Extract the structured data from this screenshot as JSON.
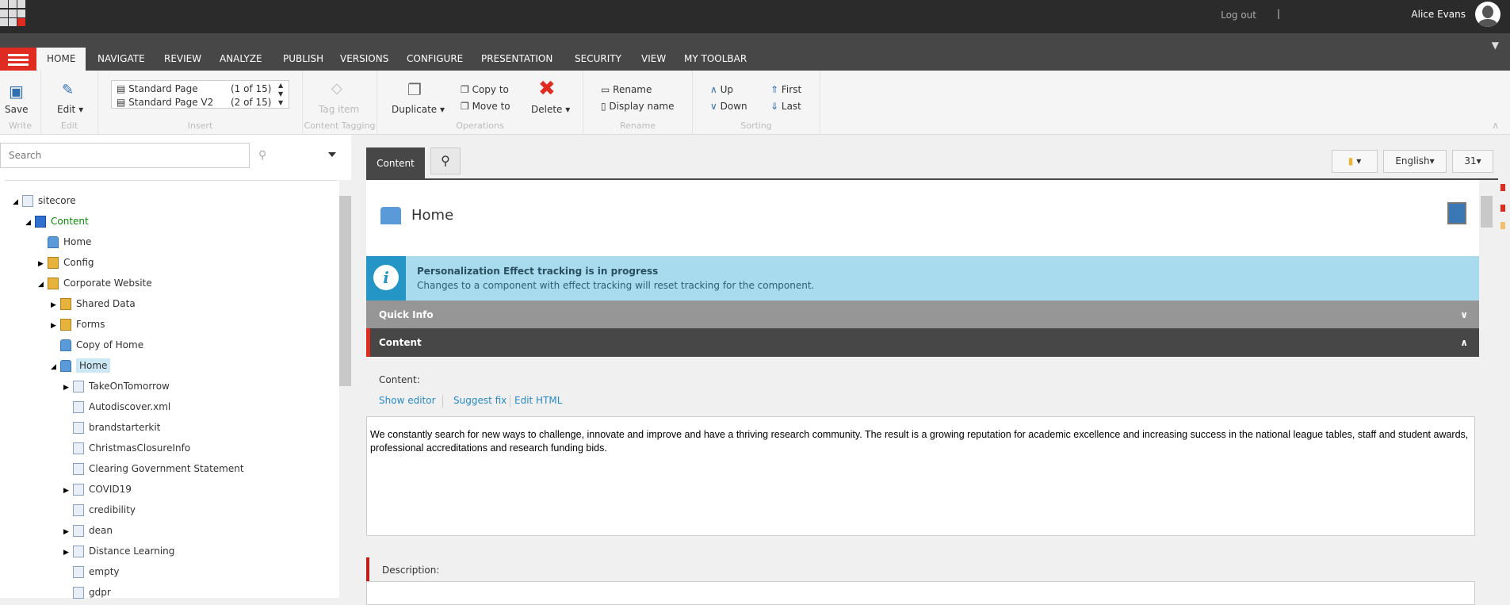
{
  "topbar": {
    "logout": "Log out",
    "separator": "|",
    "user": "Alice Evans"
  },
  "tabs": [
    "HOME",
    "NAVIGATE",
    "REVIEW",
    "ANALYZE",
    "PUBLISH",
    "VERSIONS",
    "CONFIGURE",
    "PRESENTATION",
    "SECURITY",
    "VIEW",
    "MY TOOLBAR"
  ],
  "ribbon": {
    "write": {
      "save": "Save",
      "label": "Write"
    },
    "edit": {
      "edit": "Edit",
      "label": "Edit"
    },
    "insert": {
      "items": [
        {
          "name": "Standard Page",
          "count": "(1 of 15)"
        },
        {
          "name": "Standard Page V2",
          "count": "(2 of 15)"
        }
      ],
      "label": "Insert"
    },
    "tagging": {
      "tag": "Tag item",
      "label": "Content Tagging"
    },
    "operations": {
      "duplicate": "Duplicate",
      "copy": "Copy to",
      "move": "Move to",
      "delete": "Delete",
      "label": "Operations"
    },
    "rename": {
      "rename": "Rename",
      "display": "Display name",
      "label": "Rename"
    },
    "sorting": {
      "up": "Up",
      "down": "Down",
      "first": "First",
      "last": "Last",
      "label": "Sorting"
    }
  },
  "search": {
    "placeholder": "Search"
  },
  "tree": [
    {
      "label": "sitecore",
      "level": 0,
      "toggle": "open",
      "icon": "page"
    },
    {
      "label": "Content",
      "level": 1,
      "toggle": "open",
      "icon": "cube",
      "green": true
    },
    {
      "label": "Home",
      "level": 2,
      "toggle": "",
      "icon": "home"
    },
    {
      "label": "Config",
      "level": 2,
      "toggle": "closed",
      "icon": "fold"
    },
    {
      "label": "Corporate Website",
      "level": 2,
      "toggle": "open",
      "icon": "fold"
    },
    {
      "label": "Shared Data",
      "level": 3,
      "toggle": "closed",
      "icon": "fold"
    },
    {
      "label": "Forms",
      "level": 3,
      "toggle": "closed",
      "icon": "fold"
    },
    {
      "label": "Copy of Home",
      "level": 3,
      "toggle": "",
      "icon": "home"
    },
    {
      "label": "Home",
      "level": 3,
      "toggle": "open",
      "icon": "home",
      "selected": true
    },
    {
      "label": "TakeOnTomorrow",
      "level": 4,
      "toggle": "closed",
      "icon": "page"
    },
    {
      "label": "Autodiscover.xml",
      "level": 4,
      "toggle": "",
      "icon": "page"
    },
    {
      "label": "brandstarterkit",
      "level": 4,
      "toggle": "",
      "icon": "page"
    },
    {
      "label": "ChristmasClosureInfo",
      "level": 4,
      "toggle": "",
      "icon": "page"
    },
    {
      "label": "Clearing Government Statement",
      "level": 4,
      "toggle": "",
      "icon": "page"
    },
    {
      "label": "COVID19",
      "level": 4,
      "toggle": "closed",
      "icon": "page"
    },
    {
      "label": "credibility",
      "level": 4,
      "toggle": "",
      "icon": "page"
    },
    {
      "label": "dean",
      "level": 4,
      "toggle": "closed",
      "icon": "page"
    },
    {
      "label": "Distance Learning",
      "level": 4,
      "toggle": "closed",
      "icon": "page"
    },
    {
      "label": "empty",
      "level": 4,
      "toggle": "",
      "icon": "page"
    },
    {
      "label": "gdpr",
      "level": 4,
      "toggle": "",
      "icon": "page"
    }
  ],
  "editor": {
    "content_tab": "Content",
    "language": "English",
    "version": "31",
    "item_title": "Home",
    "info_title": "Personalization Effect tracking is in progress",
    "info_text": "Changes to a component with effect tracking will reset tracking for the component.",
    "quick_info": "Quick Info",
    "content_section": "Content",
    "field_label": "Content:",
    "links": [
      "Show editor",
      "Suggest fix",
      "Edit HTML"
    ],
    "field_value": "We constantly search for new ways to challenge, innovate and improve and have a thriving research community.  The result is a growing reputation for academic excellence and increasing success in the national league tables, staff and student awards, professional accreditations and research funding bids.",
    "description_label": "Description:"
  },
  "colors": {
    "accent": "#e02b20",
    "info": "#a9dbee",
    "link": "#2a8ac5"
  }
}
